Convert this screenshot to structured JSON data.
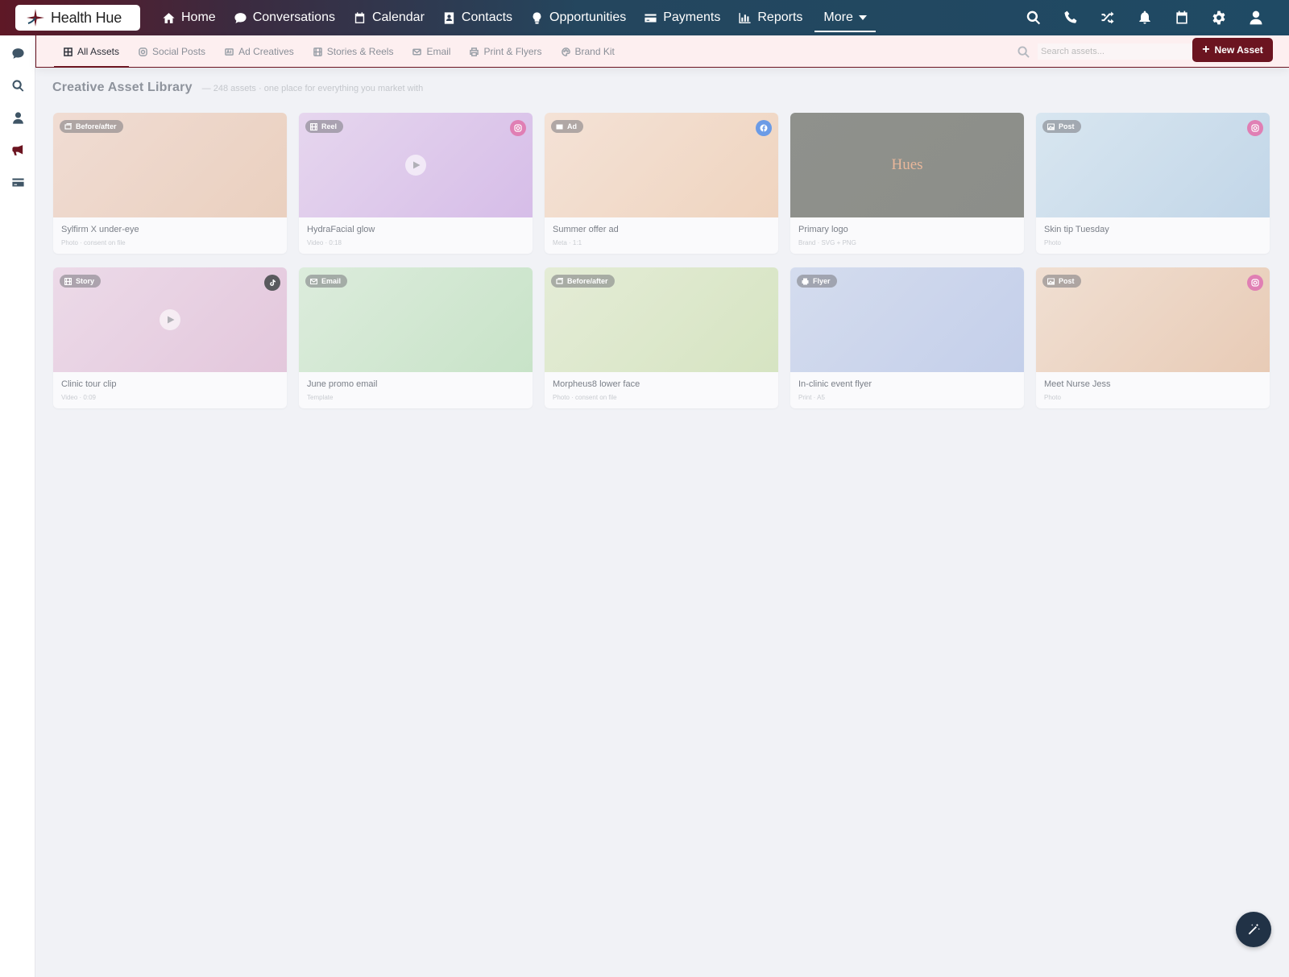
{
  "brand": {
    "name": "Health Hue",
    "accent": "#6b1420",
    "nav_gradient": [
      "#5e1826",
      "#1f4a64"
    ]
  },
  "nav": {
    "items": [
      {
        "label": "Home",
        "icon": "home-icon"
      },
      {
        "label": "Conversations",
        "icon": "chat-icon"
      },
      {
        "label": "Calendar",
        "icon": "calendar-icon"
      },
      {
        "label": "Contacts",
        "icon": "contact-card-icon"
      },
      {
        "label": "Opportunities",
        "icon": "lightbulb-icon"
      },
      {
        "label": "Payments",
        "icon": "credit-card-icon"
      },
      {
        "label": "Reports",
        "icon": "bar-chart-icon"
      }
    ],
    "more_label": "More"
  },
  "top_icons": [
    "search-icon",
    "phone-icon",
    "shuffle-icon",
    "bell-icon",
    "calendar-icon",
    "gear-icon",
    "user-icon"
  ],
  "rail_icons": [
    "chat-icon",
    "search-icon",
    "user-icon",
    "megaphone-icon",
    "credit-card-icon"
  ],
  "tabs": [
    {
      "label": "All Assets",
      "icon": "grid-icon",
      "active": true
    },
    {
      "label": "Social Posts",
      "icon": "instagram-icon",
      "active": false
    },
    {
      "label": "Ad Creatives",
      "icon": "ad-icon",
      "active": false
    },
    {
      "label": "Stories & Reels",
      "icon": "film-icon",
      "active": false
    },
    {
      "label": "Email",
      "icon": "envelope-icon",
      "active": false
    },
    {
      "label": "Print & Flyers",
      "icon": "printer-icon",
      "active": false
    },
    {
      "label": "Brand Kit",
      "icon": "palette-icon",
      "active": false
    }
  ],
  "search": {
    "placeholder": "Search assets...",
    "value": ""
  },
  "new_asset_label": "New Asset",
  "page": {
    "title": "Creative Asset Library",
    "subtitle": "— 248 assets · one place for everything you market with"
  },
  "assets": [
    {
      "title": "Sylfirm X under-eye",
      "meta": "Photo · consent on file",
      "badge": "Before/after",
      "badge_icon": "images-icon",
      "platform": "",
      "play": false,
      "logo_text": "",
      "colors": [
        "#f0dcd3",
        "#ead0bf"
      ]
    },
    {
      "title": "HydraFacial glow",
      "meta": "Video · 0:18",
      "badge": "Reel",
      "badge_icon": "film-icon",
      "platform": "instagram",
      "play": true,
      "logo_text": "",
      "colors": [
        "#e6d6ee",
        "#d6bde8"
      ]
    },
    {
      "title": "Summer offer ad",
      "meta": "Meta · 1:1",
      "badge": "Ad",
      "badge_icon": "ad-icon",
      "platform": "facebook",
      "play": false,
      "logo_text": "",
      "colors": [
        "#f4e2d6",
        "#efd4bf"
      ]
    },
    {
      "title": "Primary logo",
      "meta": "Brand · SVG + PNG",
      "badge": "",
      "badge_icon": "",
      "platform": "",
      "play": false,
      "logo_text": "Hues",
      "colors": [
        "#8f918c",
        "#8c8e89"
      ]
    },
    {
      "title": "Skin tip Tuesday",
      "meta": "Photo",
      "badge": "Post",
      "badge_icon": "image-icon",
      "platform": "instagram",
      "play": false,
      "logo_text": "",
      "colors": [
        "#d8e6f0",
        "#c2d6e8"
      ]
    },
    {
      "title": "Clinic tour clip",
      "meta": "Video · 0:09",
      "badge": "Story",
      "badge_icon": "film-icon",
      "platform": "tiktok",
      "play": true,
      "logo_text": "",
      "colors": [
        "#ecdae8",
        "#e3c7dc"
      ]
    },
    {
      "title": "June promo email",
      "meta": "Template",
      "badge": "Email",
      "badge_icon": "envelope-icon",
      "platform": "",
      "play": false,
      "logo_text": "",
      "colors": [
        "#dcecdc",
        "#c8e3c8"
      ]
    },
    {
      "title": "Morpheus8 lower face",
      "meta": "Photo · consent on file",
      "badge": "Before/after",
      "badge_icon": "images-icon",
      "platform": "",
      "play": false,
      "logo_text": "",
      "colors": [
        "#e4ecd6",
        "#d6e4c2"
      ]
    },
    {
      "title": "In-clinic event flyer",
      "meta": "Print · A5",
      "badge": "Flyer",
      "badge_icon": "printer-icon",
      "platform": "",
      "play": false,
      "logo_text": "",
      "colors": [
        "#d4dcee",
        "#c4cfea"
      ]
    },
    {
      "title": "Meet Nurse Jess",
      "meta": "Photo",
      "badge": "Post",
      "badge_icon": "image-icon",
      "platform": "instagram",
      "play": false,
      "logo_text": "",
      "colors": [
        "#f0dfd2",
        "#e8cbb6"
      ]
    }
  ],
  "platform_colors": {
    "instagram": "#e07fb4",
    "facebook": "#6b9be6",
    "tiktok": "#5a5a5e"
  },
  "fab_icon": "magic-wand-icon"
}
